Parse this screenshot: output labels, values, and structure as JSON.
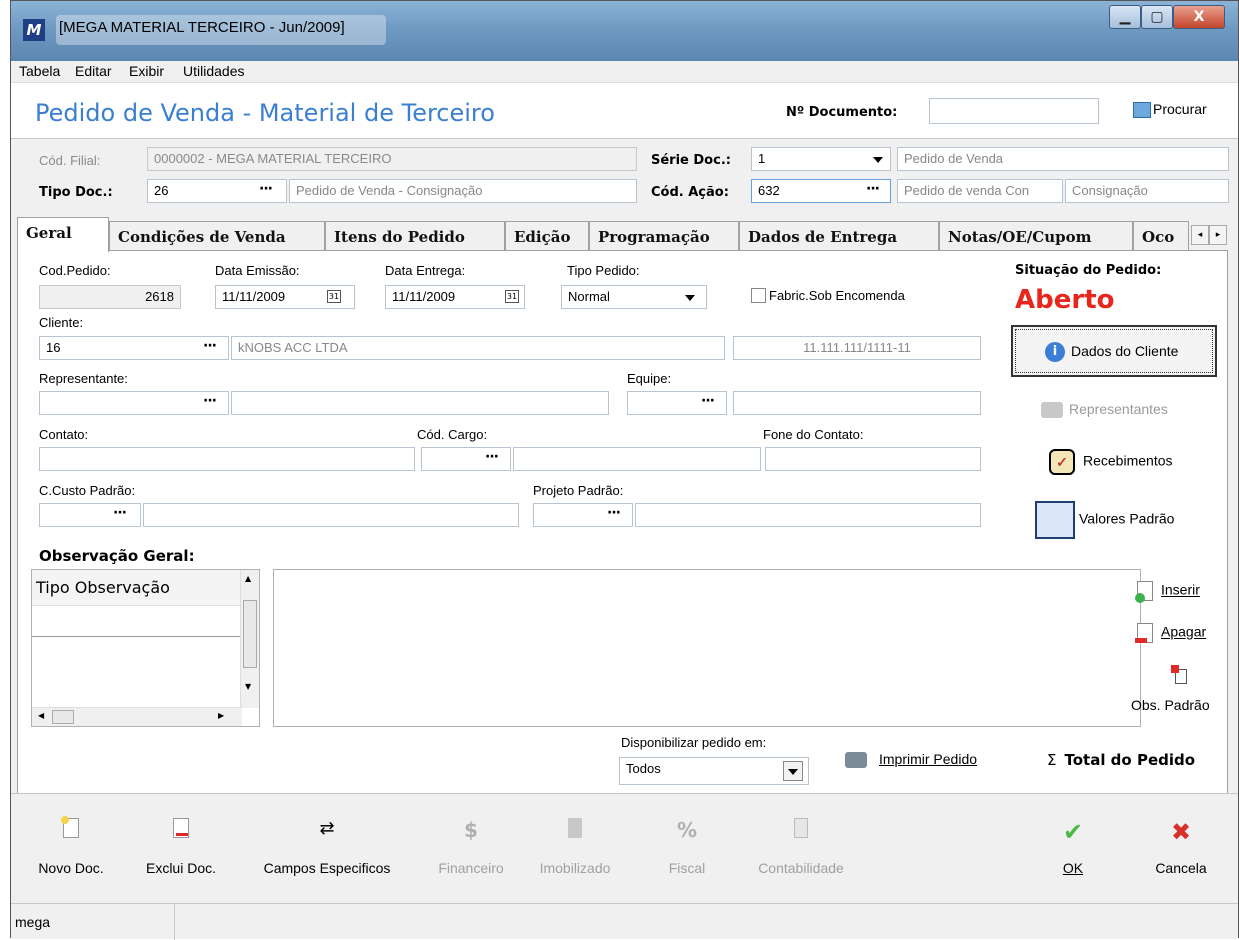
{
  "window": {
    "title": "[MEGA MATERIAL TERCEIRO - Jun/2009]",
    "app_icon": "mega-logo-icon",
    "minimize_icon": "minimize-icon",
    "maximize_icon": "maximize-icon",
    "close_icon": "close-icon"
  },
  "menu": [
    {
      "label": "Tabela",
      "underline": "T"
    },
    {
      "label": "Editar",
      "underline": "E"
    },
    {
      "label": "Exibir",
      "underline": "x"
    },
    {
      "label": "Utilidades",
      "underline": "U"
    }
  ],
  "header": {
    "title": "Pedido de Venda - Material de Terceiro",
    "doc_number_label": "Nº Documento:",
    "doc_number_value": "",
    "search_label": "Procurar"
  },
  "form_top": {
    "filial_label": "Cód. Filial:",
    "filial_value": "0000002 - MEGA MATERIAL TERCEIRO",
    "tipo_doc_label": "Tipo Doc.:",
    "tipo_doc_code": "26",
    "tipo_doc_desc": "Pedido de Venda - Consignação",
    "serie_label": "Série Doc.:",
    "serie_value": "1",
    "serie_desc": "Pedido de Venda",
    "acao_label": "Cód. Ação:",
    "acao_code": "632",
    "acao_desc1": "Pedido de venda Con",
    "acao_desc2": "Consignação"
  },
  "tabs": [
    "Geral",
    "Condições de Venda",
    "Itens do Pedido",
    "Edição",
    "Programação",
    "Dados de Entrega",
    "Notas/OE/Cupom",
    "Oco"
  ],
  "geral": {
    "cod_pedido_label": "Cod.Pedido:",
    "cod_pedido_value": "2618",
    "data_emissao_label": "Data Emissão:",
    "data_emissao_value": "11/11/2009",
    "data_entrega_label": "Data Entrega:",
    "data_entrega_value": "11/11/2009",
    "tipo_pedido_label": "Tipo Pedido:",
    "tipo_pedido_value": "Normal",
    "fabric_label": "Fabric.Sob Encomenda",
    "fabric_checked": false,
    "situacao_label": "Situação do Pedido:",
    "situacao_value": "Aberto",
    "situacao_color": "#e8261c",
    "cliente_label": "Cliente:",
    "cliente_code": "16",
    "cliente_name": "kNOBS ACC LTDA",
    "cliente_cnpj": "11.111.111/1111-11",
    "representante_label": "Representante:",
    "representante_code": "",
    "representante_name": "",
    "equipe_label": "Equipe:",
    "contato_label": "Contato:",
    "cargo_label": "Cód. Cargo:",
    "fone_label": "Fone do Contato:",
    "ccusto_label": "C.Custo Padrão:",
    "projeto_label": "Projeto Padrão:",
    "obs_label": "Observação Geral:",
    "obs_col_header": "Tipo Observação",
    "disponibilizar_label": "Disponibilizar pedido em:",
    "disponibilizar_value": "Todos",
    "imprimir_label": "Imprimir Pedido",
    "total_label": "Total do Pedido"
  },
  "side_buttons": {
    "dados_cliente": "Dados do Cliente",
    "representantes": "Representantes",
    "recebimentos": "Recebimentos",
    "valores_padrao": "Valores Padrão",
    "inserir": "Inserir",
    "apagar": "Apagar",
    "obs_padrao": "Obs. Padrão"
  },
  "toolbar": [
    {
      "label": "Novo Doc.",
      "icon": "new-document-icon",
      "enabled": true
    },
    {
      "label": "Exclui Doc.",
      "icon": "delete-document-icon",
      "enabled": true
    },
    {
      "label": "Campos Especificos",
      "icon": "specific-fields-icon",
      "enabled": true
    },
    {
      "label": "Financeiro",
      "icon": "money-icon",
      "enabled": false
    },
    {
      "label": "Imobilizado",
      "icon": "asset-icon",
      "enabled": false
    },
    {
      "label": "Fiscal",
      "icon": "percent-icon",
      "enabled": false
    },
    {
      "label": "Contabilidade",
      "icon": "ledger-icon",
      "enabled": false
    },
    {
      "label": "OK",
      "icon": "check-icon",
      "enabled": true
    },
    {
      "label": "Cancela",
      "icon": "x-icon",
      "enabled": true
    }
  ],
  "status": {
    "user": "mega"
  }
}
